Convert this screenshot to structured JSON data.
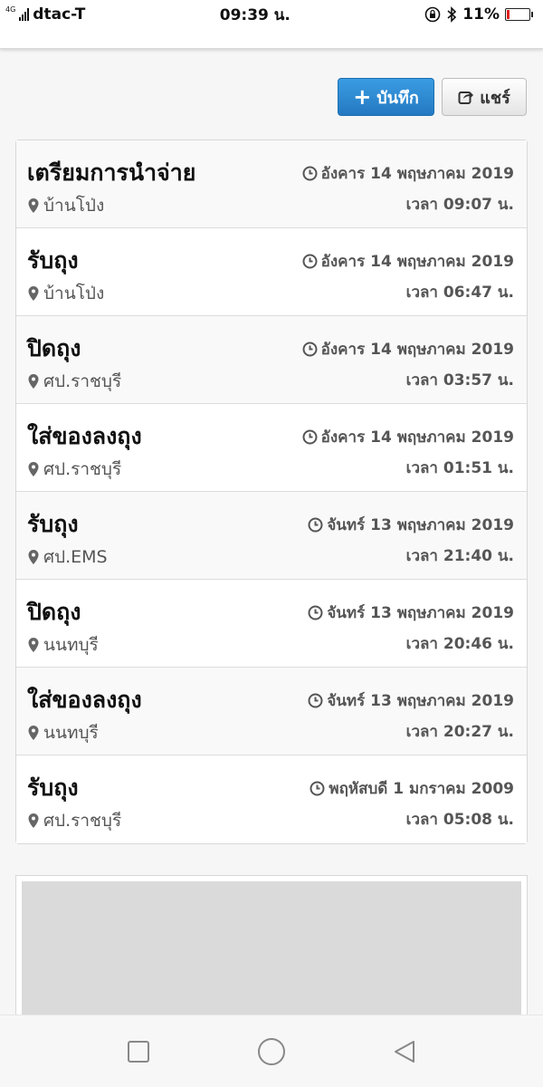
{
  "status_bar": {
    "network": "4G",
    "carrier": "dtac-T",
    "time": "09:39 น.",
    "battery": "11%",
    "battery_level": 0.11
  },
  "toolbar": {
    "save_label": "บันทึก",
    "share_label": "แชร์"
  },
  "events": [
    {
      "title": "เตรียมการนำจ่าย",
      "place": "บ้านโป่ง",
      "date": "อังคาร 14 พฤษภาคม 2019",
      "time": "เวลา 09:07 น."
    },
    {
      "title": "รับถุง",
      "place": "บ้านโป่ง",
      "date": "อังคาร 14 พฤษภาคม 2019",
      "time": "เวลา 06:47 น."
    },
    {
      "title": "ปิดถุง",
      "place": "ศป.ราชบุรี",
      "date": "อังคาร 14 พฤษภาคม 2019",
      "time": "เวลา 03:57 น."
    },
    {
      "title": "ใส่ของลงถุง",
      "place": "ศป.ราชบุรี",
      "date": "อังคาร 14 พฤษภาคม 2019",
      "time": "เวลา 01:51 น."
    },
    {
      "title": "รับถุง",
      "place": "ศป.EMS",
      "date": "จันทร์ 13 พฤษภาคม 2019",
      "time": "เวลา 21:40 น."
    },
    {
      "title": "ปิดถุง",
      "place": "นนทบุรี",
      "date": "จันทร์ 13 พฤษภาคม 2019",
      "time": "เวลา 20:46 น."
    },
    {
      "title": "ใส่ของลงถุง",
      "place": "นนทบุรี",
      "date": "จันทร์ 13 พฤษภาคม 2019",
      "time": "เวลา 20:27 น."
    },
    {
      "title": "รับถุง",
      "place": "ศป.ราชบุรี",
      "date": "พฤหัสบดี 1 มกราคม 2009",
      "time": "เวลา 05:08 น."
    }
  ],
  "colors": {
    "primary": "#2f8fd6",
    "battery_low": "#e02020"
  }
}
